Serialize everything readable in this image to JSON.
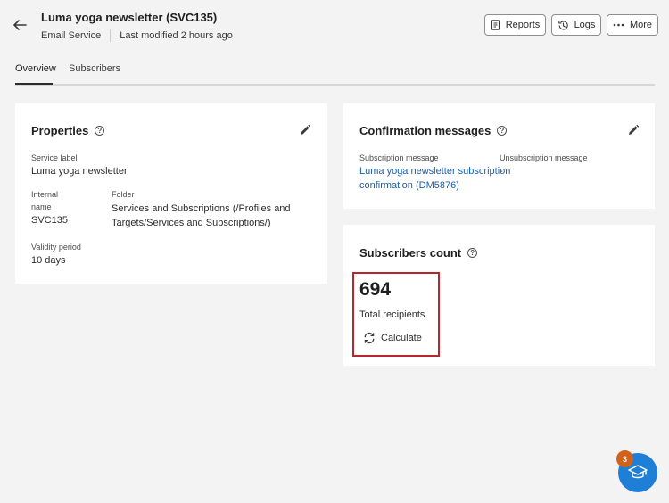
{
  "header": {
    "title": "Luma yoga newsletter (SVC135)",
    "service_type": "Email Service",
    "last_modified": "Last modified 2 hours ago",
    "buttons": {
      "reports": "Reports",
      "logs": "Logs",
      "more": "More"
    }
  },
  "tabs": [
    {
      "label": "Overview",
      "active": true
    },
    {
      "label": "Subscribers",
      "active": false
    }
  ],
  "properties": {
    "title": "Properties",
    "service_label_label": "Service label",
    "service_label_value": "Luma yoga newsletter",
    "internal_name_label_1": "Internal",
    "internal_name_label_2": "name",
    "internal_name_value": "SVC135",
    "folder_label": "Folder",
    "folder_value_1": "Services and Subscriptions (/Profiles and",
    "folder_value_2": "Targets/Services and Subscriptions/)",
    "validity_label": "Validity period",
    "validity_value": "10 days"
  },
  "confirmation": {
    "title": "Confirmation messages",
    "subscription_label": "Subscription message",
    "subscription_value_1": "Luma yoga newsletter subscription",
    "subscription_value_2": "confirmation (DM5876)",
    "unsubscription_label": "Unsubscription message",
    "unsubscription_value": "-"
  },
  "subscribers_count": {
    "title": "Subscribers count",
    "count": "694",
    "count_label": "Total recipients",
    "calculate_label": "Calculate"
  },
  "fab": {
    "badge": "3",
    "icon": "graduation-cap-icon"
  },
  "colors": {
    "link": "#1b5fb0",
    "highlight": "#b8262a",
    "fab": "#1f7fd6",
    "badge": "#d0621b"
  }
}
